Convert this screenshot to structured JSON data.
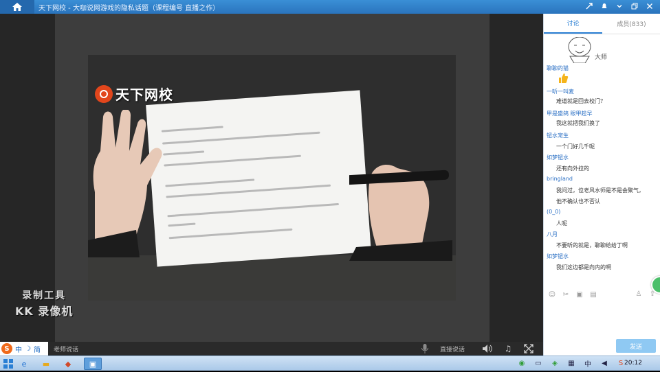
{
  "window": {
    "title": "天下网校 - 大咖说网游戏的隐私话题（课程编号 直播之作）",
    "controls": [
      "mode-icon",
      "bell-icon",
      "chevron-down-icon",
      "restore-icon",
      "close-icon"
    ]
  },
  "video": {
    "watermark_brand": "天下网校",
    "recorder_line1": "录制工具",
    "recorder_line2": "KK 录像机"
  },
  "controlbar": {
    "ime_label": "中",
    "ime_mode": "简",
    "left_label": "老师说话",
    "right_label": "直接说话"
  },
  "panel": {
    "tabs": [
      {
        "label": "讨论",
        "active": true
      },
      {
        "label": "成员(833)",
        "active": false
      }
    ],
    "avatar_name": "大师",
    "messages": [
      {
        "name": "聊聊的猫",
        "text": ""
      },
      {
        "name": "一听一叫麦",
        "text": "难道就是回去校门？"
      },
      {
        "name": "甲是盛鸽 眼甲趁早",
        "text": "我这就把我们换了"
      },
      {
        "name": "钮水宠生",
        "text": "一个门好几千呢"
      },
      {
        "name": "如梦钮水",
        "text": "还有向外拉的"
      },
      {
        "name": "bringland",
        "text": "我问过，位老风水师是不是会聚气，"
      },
      {
        "name": "",
        "text": "他不确认也不否认"
      },
      {
        "name": "(0_0)",
        "text": "人呢"
      },
      {
        "name": "八月",
        "text": "不要听的就是，聊聊给给丁啊"
      },
      {
        "name": "如梦钮水",
        "text": "我们这边都是向内的啊"
      }
    ],
    "send_label": "发送"
  },
  "taskbar": {
    "clock": "20:12",
    "tray_lang": "中"
  },
  "colors": {
    "accent": "#2a7fd4",
    "titlebar": "#2a74bd",
    "name_blue": "#2a6fc4",
    "send_button": "#8fc9f3"
  }
}
